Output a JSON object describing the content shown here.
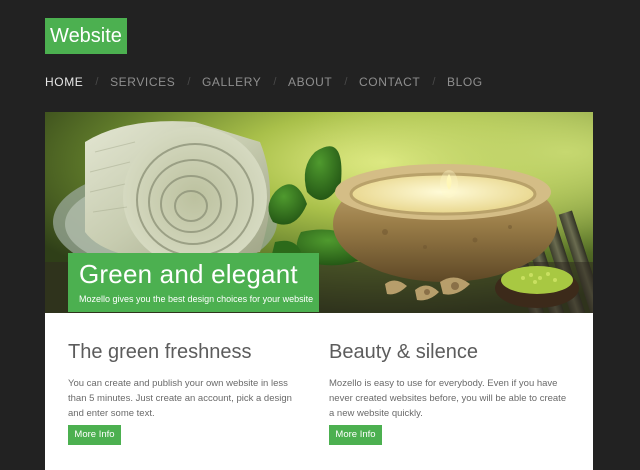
{
  "site": {
    "logo": "Website"
  },
  "nav": {
    "items": [
      {
        "label": "HOME",
        "active": true
      },
      {
        "label": "SERVICES",
        "active": false
      },
      {
        "label": "GALLERY",
        "active": false
      },
      {
        "label": "ABOUT",
        "active": false
      },
      {
        "label": "CONTACT",
        "active": false
      },
      {
        "label": "BLOG",
        "active": false
      }
    ],
    "separator": "/"
  },
  "hero": {
    "title": "Green and elegant",
    "subtitle": "Mozello gives you the best design choices for your website"
  },
  "features": [
    {
      "title": "The green freshness",
      "text": "You can create and publish your own website in less than 5 minutes. Just create an account, pick a design and enter some text.",
      "button": "More Info"
    },
    {
      "title": "Beauty & silence",
      "text": "Mozello is easy to use for everybody. Even if you have never created websites before, you will be able to create a new website quickly.",
      "button": "More Info"
    }
  ],
  "colors": {
    "background": "#222222",
    "accent": "#4cb050",
    "nav_text": "#8f8f8f",
    "nav_active": "#e6e6e6",
    "heading": "#5c5c5c",
    "body_text": "#6a6a6a"
  }
}
